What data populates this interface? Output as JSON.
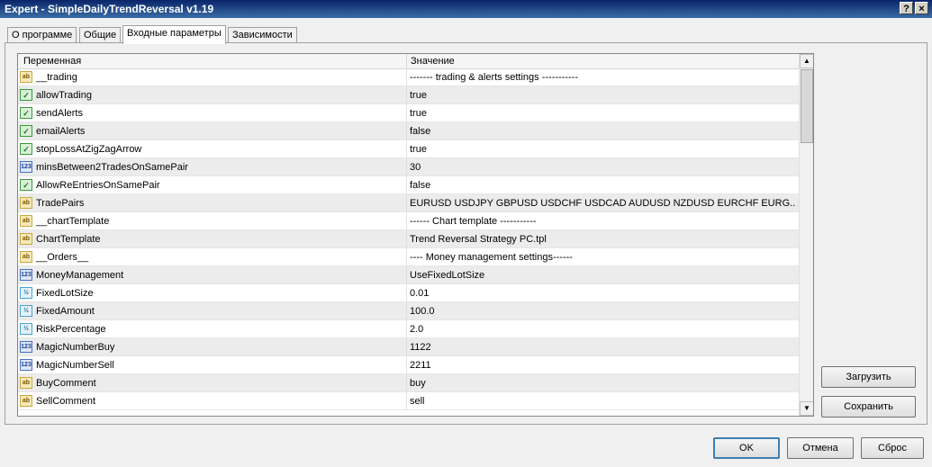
{
  "window": {
    "title": "Expert - SimpleDailyTrendReversal v1.19",
    "help_label": "?",
    "close_label": "×"
  },
  "tabs": [
    {
      "label": "О программе"
    },
    {
      "label": "Общие"
    },
    {
      "label": "Входные параметры"
    },
    {
      "label": "Зависимости"
    }
  ],
  "grid": {
    "col_variable": "Переменная",
    "col_value": "Значение",
    "rows": [
      {
        "icon": "ab",
        "name": "__trading",
        "value": " ------- trading & alerts settings -----------"
      },
      {
        "icon": "bool",
        "name": "allowTrading",
        "value": "true"
      },
      {
        "icon": "bool",
        "name": "sendAlerts",
        "value": "true"
      },
      {
        "icon": "bool",
        "name": "emailAlerts",
        "value": "false"
      },
      {
        "icon": "bool",
        "name": "stopLossAtZigZagArrow",
        "value": "true"
      },
      {
        "icon": "int",
        "name": "minsBetween2TradesOnSamePair",
        "value": "30"
      },
      {
        "icon": "bool",
        "name": "AllowReEntriesOnSamePair",
        "value": "false"
      },
      {
        "icon": "ab",
        "name": "TradePairs",
        "value": "EURUSD USDJPY GBPUSD USDCHF USDCAD AUDUSD NZDUSD EURCHF EURG..."
      },
      {
        "icon": "ab",
        "name": "__chartTemplate",
        "value": " ------ Chart template -----------"
      },
      {
        "icon": "ab",
        "name": "ChartTemplate",
        "value": "Trend Reversal Strategy PC.tpl"
      },
      {
        "icon": "ab",
        "name": "__Orders__",
        "value": " ---- Money management settings------"
      },
      {
        "icon": "int",
        "name": "MoneyManagement",
        "value": "UseFixedLotSize"
      },
      {
        "icon": "dbl",
        "name": "FixedLotSize",
        "value": "0.01"
      },
      {
        "icon": "dbl",
        "name": "FixedAmount",
        "value": "100.0"
      },
      {
        "icon": "dbl",
        "name": "RiskPercentage",
        "value": "2.0"
      },
      {
        "icon": "int",
        "name": "MagicNumberBuy",
        "value": "1122"
      },
      {
        "icon": "int",
        "name": "MagicNumberSell",
        "value": "2211"
      },
      {
        "icon": "ab",
        "name": "BuyComment",
        "value": "buy"
      },
      {
        "icon": "ab",
        "name": "SellComment",
        "value": "sell"
      }
    ]
  },
  "icons": {
    "ab": "ab",
    "bool": "✓",
    "int": "123",
    "dbl": "½"
  },
  "buttons": {
    "load": "Загрузить",
    "save": "Сохранить",
    "ok": "OK",
    "cancel": "Отмена",
    "reset": "Сброс"
  }
}
